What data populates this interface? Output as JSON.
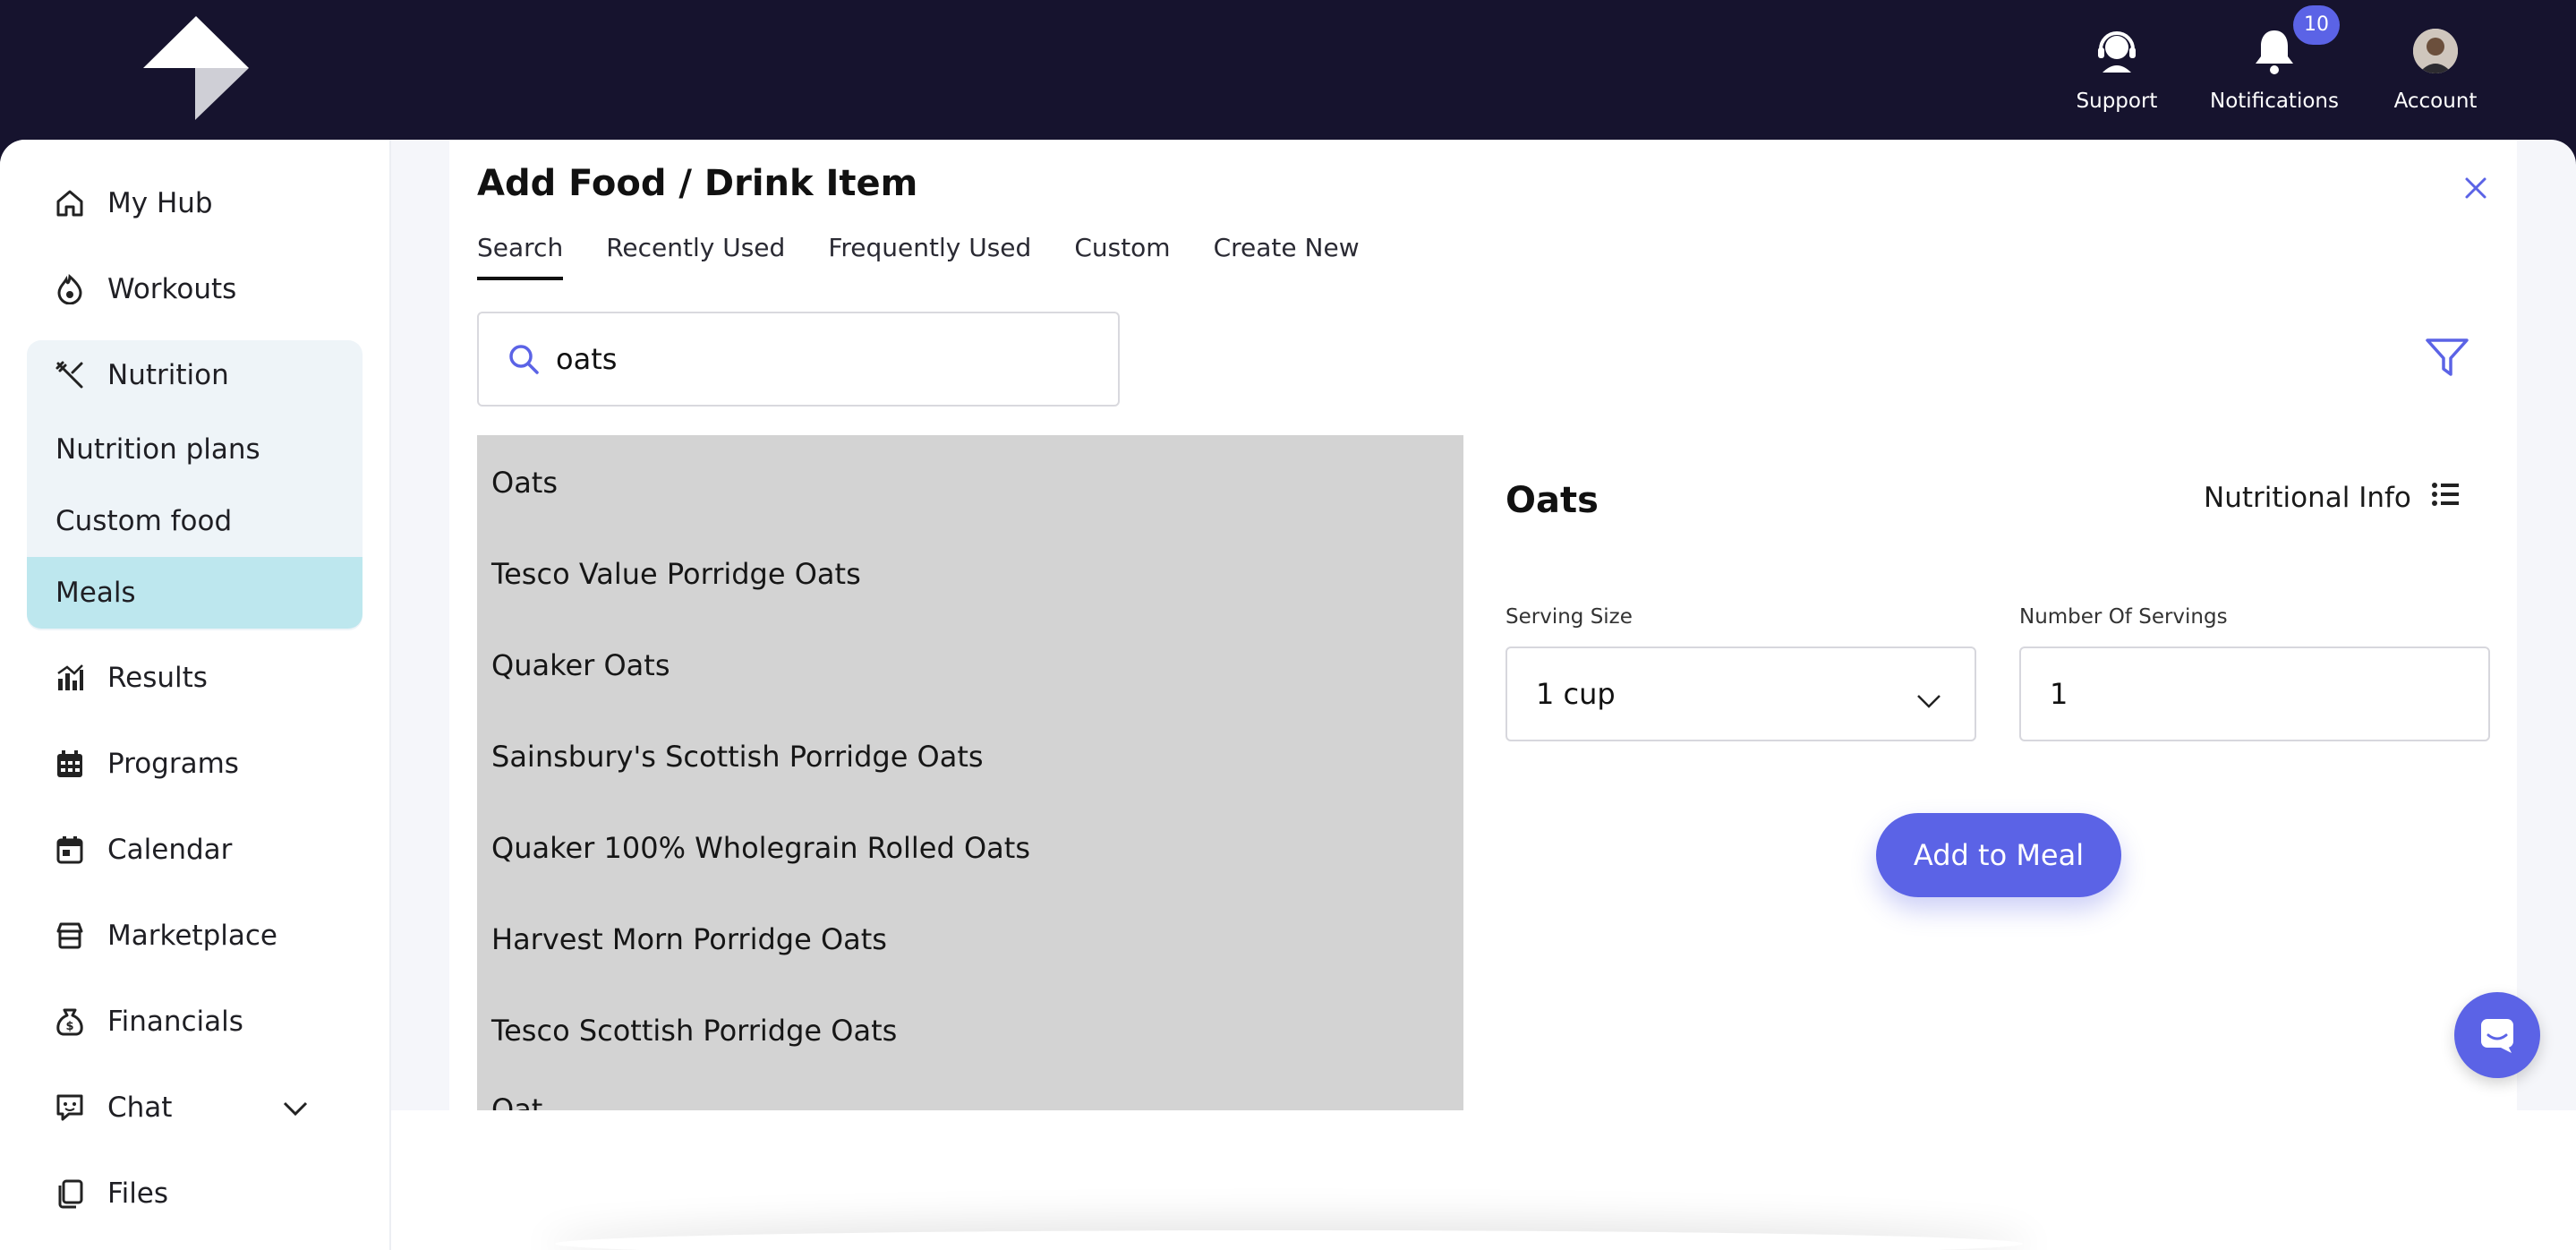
{
  "topbar": {
    "logo": "app-logo",
    "support_label": "Support",
    "notifications_label": "Notifications",
    "notifications_count": "10",
    "account_label": "Account"
  },
  "sidebar": {
    "items": [
      {
        "label": "My Hub",
        "icon": "home-icon"
      },
      {
        "label": "Workouts",
        "icon": "flame-icon"
      },
      {
        "label": "Nutrition",
        "icon": "utensils-icon"
      },
      {
        "label": "Results",
        "icon": "chart-icon"
      },
      {
        "label": "Programs",
        "icon": "calendar-grid-icon"
      },
      {
        "label": "Calendar",
        "icon": "calendar-icon"
      },
      {
        "label": "Marketplace",
        "icon": "store-icon"
      },
      {
        "label": "Financials",
        "icon": "money-bag-icon"
      },
      {
        "label": "Chat",
        "icon": "chat-icon"
      },
      {
        "label": "Files",
        "icon": "files-icon"
      }
    ],
    "nutrition_sub": [
      "Nutrition plans",
      "Custom food",
      "Meals"
    ],
    "active_sub": "Meals"
  },
  "dialog": {
    "title": "Add Food / Drink Item",
    "tabs": [
      "Search",
      "Recently Used",
      "Frequently Used",
      "Custom",
      "Create New"
    ],
    "active_tab": "Search",
    "search_value": "oats",
    "results": [
      "Oats",
      "Tesco Value Porridge Oats",
      "Quaker Oats",
      "Sainsbury's Scottish Porridge Oats",
      "Quaker 100% Wholegrain Rolled Oats",
      "Harvest Morn Porridge Oats",
      "Tesco Scottish Porridge Oats",
      "Oat..."
    ],
    "detail": {
      "name": "Oats",
      "nutritional_info_label": "Nutritional Info",
      "serving_size_label": "Serving Size",
      "serving_size_value": "1 cup",
      "servings_label": "Number Of Servings",
      "servings_value": "1",
      "add_button": "Add to Meal"
    }
  },
  "colors": {
    "topbar": "#16132e",
    "accent": "#5b63e6",
    "active_nav": "#bde7ee",
    "results_bg": "#d3d3d3"
  }
}
